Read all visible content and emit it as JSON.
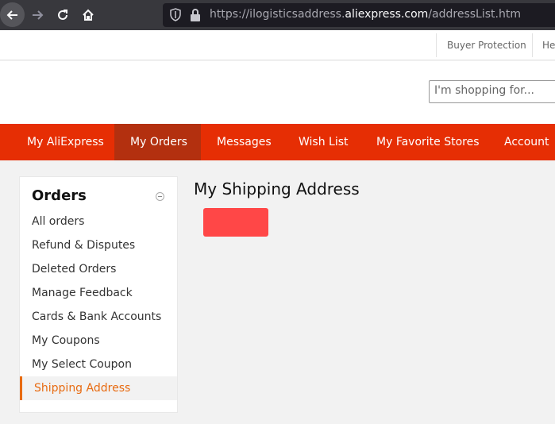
{
  "browser": {
    "url_prefix": "https://ilogisticsaddress.",
    "url_domain": "aliexpress.com",
    "url_path": "/addressList.htm"
  },
  "util_strip": {
    "buyer_protection": "Buyer Protection",
    "help": "He"
  },
  "search": {
    "placeholder": "I'm shopping for..."
  },
  "main_nav": {
    "items": [
      {
        "label": "My AliExpress"
      },
      {
        "label": "My Orders"
      },
      {
        "label": "Messages"
      },
      {
        "label": "Wish List"
      },
      {
        "label": "My Favorite Stores"
      },
      {
        "label": "Account"
      }
    ],
    "active": "My Orders"
  },
  "sidebar": {
    "title": "Orders",
    "items": [
      {
        "label": "All orders"
      },
      {
        "label": "Refund & Disputes"
      },
      {
        "label": "Deleted Orders"
      },
      {
        "label": "Manage Feedback"
      },
      {
        "label": "Cards & Bank Accounts"
      },
      {
        "label": "My Coupons"
      },
      {
        "label": "My Select Coupon"
      },
      {
        "label": "Shipping Address"
      }
    ],
    "active": "Shipping Address"
  },
  "main": {
    "title": "My Shipping Address",
    "add_button_label": ""
  },
  "colors": {
    "nav_red": "#e62e04",
    "nav_active": "#b3300f",
    "accent_orange": "#e86b11",
    "button_red": "#ff4747"
  }
}
